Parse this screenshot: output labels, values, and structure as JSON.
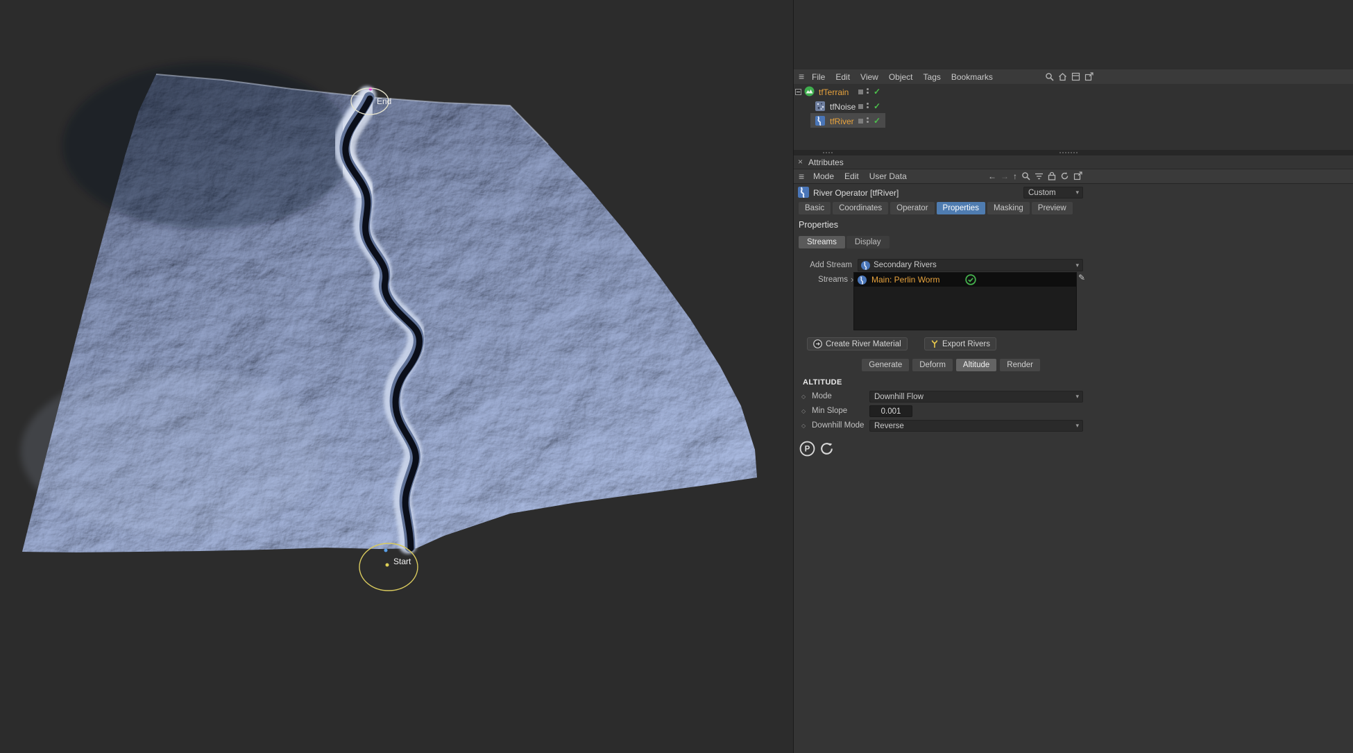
{
  "colors": {
    "accent_orange": "#e8a33d",
    "selection_blue": "#4f7cb0",
    "check_green": "#4cc04c",
    "terrain_blue": "#8fa3cf"
  },
  "icons": {
    "hamburger": "≡",
    "close": "×",
    "caret_down": "▾",
    "check": "✓",
    "pencil": "✎",
    "diamond_bullet": "◇",
    "arrow_left": "←",
    "arrow_right": "→",
    "arrow_up": "↑",
    "streams_arrow": "›",
    "letter_p": "P"
  },
  "top_menu": {
    "items": [
      "File",
      "Edit",
      "View",
      "Object",
      "Tags",
      "Bookmarks"
    ]
  },
  "object_manager": {
    "rows": [
      {
        "name": "tfTerrain"
      },
      {
        "name": "tfNoise"
      },
      {
        "name": "tfRiver"
      }
    ]
  },
  "attributes": {
    "title": "Attributes",
    "menu_items": [
      "Mode",
      "Edit",
      "User Data"
    ],
    "object_header": {
      "title": "River Operator [tfRiver]",
      "preset": "Custom"
    },
    "tabs": [
      "Basic",
      "Coordinates",
      "Operator",
      "Properties",
      "Masking",
      "Preview"
    ],
    "active_tab": "Properties",
    "section_title": "Properties",
    "subtabs": [
      "Streams",
      "Display"
    ],
    "active_subtab": "Streams",
    "stream_panel": {
      "add_stream_label": "Add Stream",
      "add_stream_value": "Secondary Rivers",
      "streams_label": "Streams",
      "stream_items": [
        {
          "name": "Main: Perlin Worm"
        }
      ],
      "create_material_label": "Create River Material",
      "export_rivers_label": "Export Rivers"
    },
    "actions": [
      "Generate",
      "Deform",
      "Altitude",
      "Render"
    ],
    "active_action": "Altitude",
    "altitude": {
      "title": "ALTITUDE",
      "mode_label": "Mode",
      "mode_value": "Downhill Flow",
      "min_slope_label": "Min Slope",
      "min_slope_value": "0.001",
      "downhill_label": "Downhill Mode",
      "downhill_value": "Reverse"
    }
  },
  "viewport": {
    "end_label": "End",
    "start_label": "Start"
  }
}
